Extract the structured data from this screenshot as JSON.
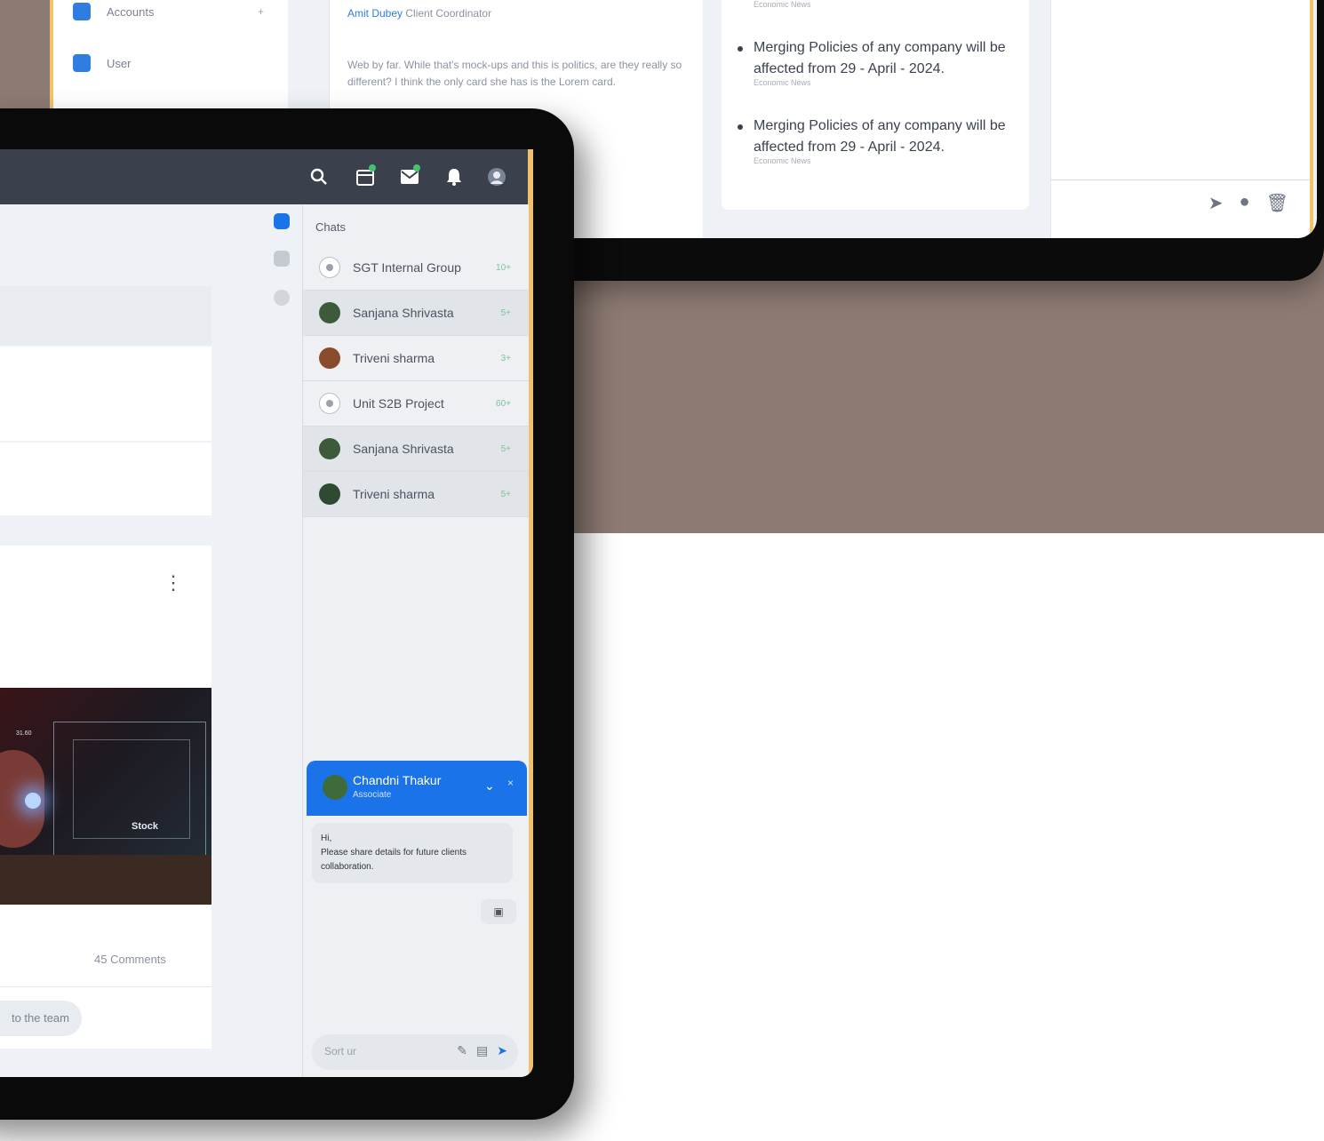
{
  "back_tablet": {
    "sidebar": {
      "items": [
        {
          "label": "Accounts",
          "icon": "accounts-icon",
          "chevron": "+"
        },
        {
          "label": "User",
          "icon": "user-icon"
        }
      ]
    },
    "post": {
      "author_name": "Amit Dubey",
      "author_role": "Client Coordinator",
      "text": "Web by far. While that's mock-ups and this is politics, are they really so different? I think the only card she has is the Lorem card."
    },
    "news": [
      {
        "title": "Merging Policies of any company will be affected from 29 - April - 2024.",
        "source": "Economic News"
      },
      {
        "title": "Merging Policies of any company will be affected from 29 - April - 2024.",
        "source": "Economic News"
      }
    ],
    "actions": [
      "send-icon",
      "palette-icon",
      "delete-icon"
    ]
  },
  "front_tablet": {
    "topbar": {
      "icons": [
        "search-icon",
        "calendar-icon",
        "mail-icon",
        "bell-icon",
        "profile-icon"
      ],
      "accent": "#3a414c"
    },
    "feed": {
      "post_comments": "45 Comments",
      "image_label": "Stock",
      "image_sublabel": "31.60",
      "pill_text": "to the team"
    },
    "chats": {
      "title": "Chats",
      "items": [
        {
          "name": "SGT Internal Group",
          "count": "10+",
          "type": "group"
        },
        {
          "name": "Sanjana Shrivasta",
          "count": "5+",
          "type": "person"
        },
        {
          "name": "Triveni sharma",
          "count": "3+",
          "type": "person"
        },
        {
          "name": "Unit S2B Project",
          "count": "60+",
          "type": "group"
        },
        {
          "name": "Sanjana Shrivasta",
          "count": "5+",
          "type": "person"
        },
        {
          "name": "Triveni sharma",
          "count": "5+",
          "type": "person"
        }
      ]
    },
    "chat_window": {
      "name": "Chandni Thakur",
      "role": "Associate",
      "message_line1": "Hi,",
      "message_line2": "Please share details for future clients collaboration.",
      "input_placeholder": "Sort ur",
      "accent": "#1a73e8"
    }
  },
  "colors": {
    "background_band": "#8d7b73",
    "tablet_frame": "#0a0a0a",
    "highlight_edge": "#f0c06a"
  }
}
